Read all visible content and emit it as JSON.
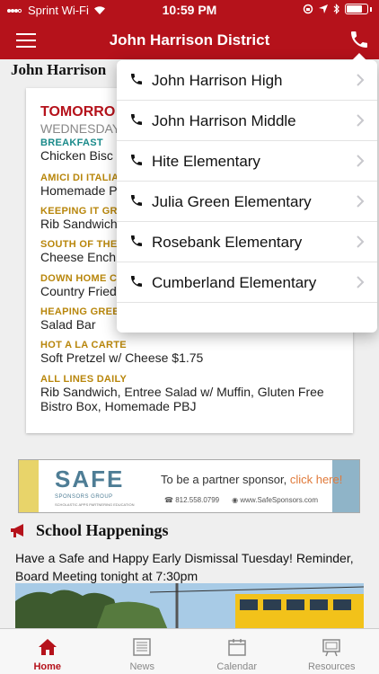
{
  "status_bar": {
    "carrier": "Sprint Wi-Fi",
    "time": "10:59 PM"
  },
  "nav": {
    "title": "John Harrison District"
  },
  "school_header": "John Harrison",
  "menu": {
    "day": "TOMORRO",
    "date": "WEDNESDAY",
    "sections": [
      {
        "label": "BREAKFAST",
        "text": "Chicken Bisc"
      },
      {
        "label": "AMICI DI ITALIA",
        "text": "Homemade P"
      },
      {
        "label": "KEEPING IT GR",
        "text": "Rib Sandwich"
      },
      {
        "label": "SOUTH OF THE",
        "text": "Cheese Ench"
      },
      {
        "label": "DOWN HOME C",
        "text": "Country Fried"
      },
      {
        "label": "HEAPING GREE",
        "text": "Salad Bar"
      },
      {
        "label": "HOT A LA CARTE",
        "text": "Soft Pretzel w/ Cheese $1.75"
      },
      {
        "label": "ALL LINES DAILY",
        "text": "Rib Sandwich, Entree Salad w/ Muffin, Gluten Free Bistro Box, Homemade PBJ"
      }
    ]
  },
  "ad": {
    "logo": "SAFE",
    "logo_sub": "SPONSORS GROUP",
    "logo_sub2": "SCHOLASTIC APPS PARTNERING EDUCATION",
    "headline": "To be a partner sponsor,",
    "cta": "click here!",
    "phone": "812.558.0799",
    "website": "www.SafeSponsors.com"
  },
  "happenings": {
    "title": "School Happenings",
    "text": "Have a Safe and Happy Early Dismissal Tuesday! Reminder, Board Meeting tonight at 7:30pm"
  },
  "tabs": [
    {
      "label": "Home"
    },
    {
      "label": "News"
    },
    {
      "label": "Calendar"
    },
    {
      "label": "Resources"
    }
  ],
  "dropdown": {
    "items": [
      {
        "label": "John Harrison High"
      },
      {
        "label": "John Harrison Middle"
      },
      {
        "label": "Hite Elementary"
      },
      {
        "label": "Julia Green Elementary"
      },
      {
        "label": "Rosebank Elementary"
      },
      {
        "label": "Cumberland Elementary"
      }
    ]
  },
  "colors": {
    "brand": "#b5121b",
    "label_gold": "#b8860b",
    "label_teal": "#1a8a8a"
  }
}
